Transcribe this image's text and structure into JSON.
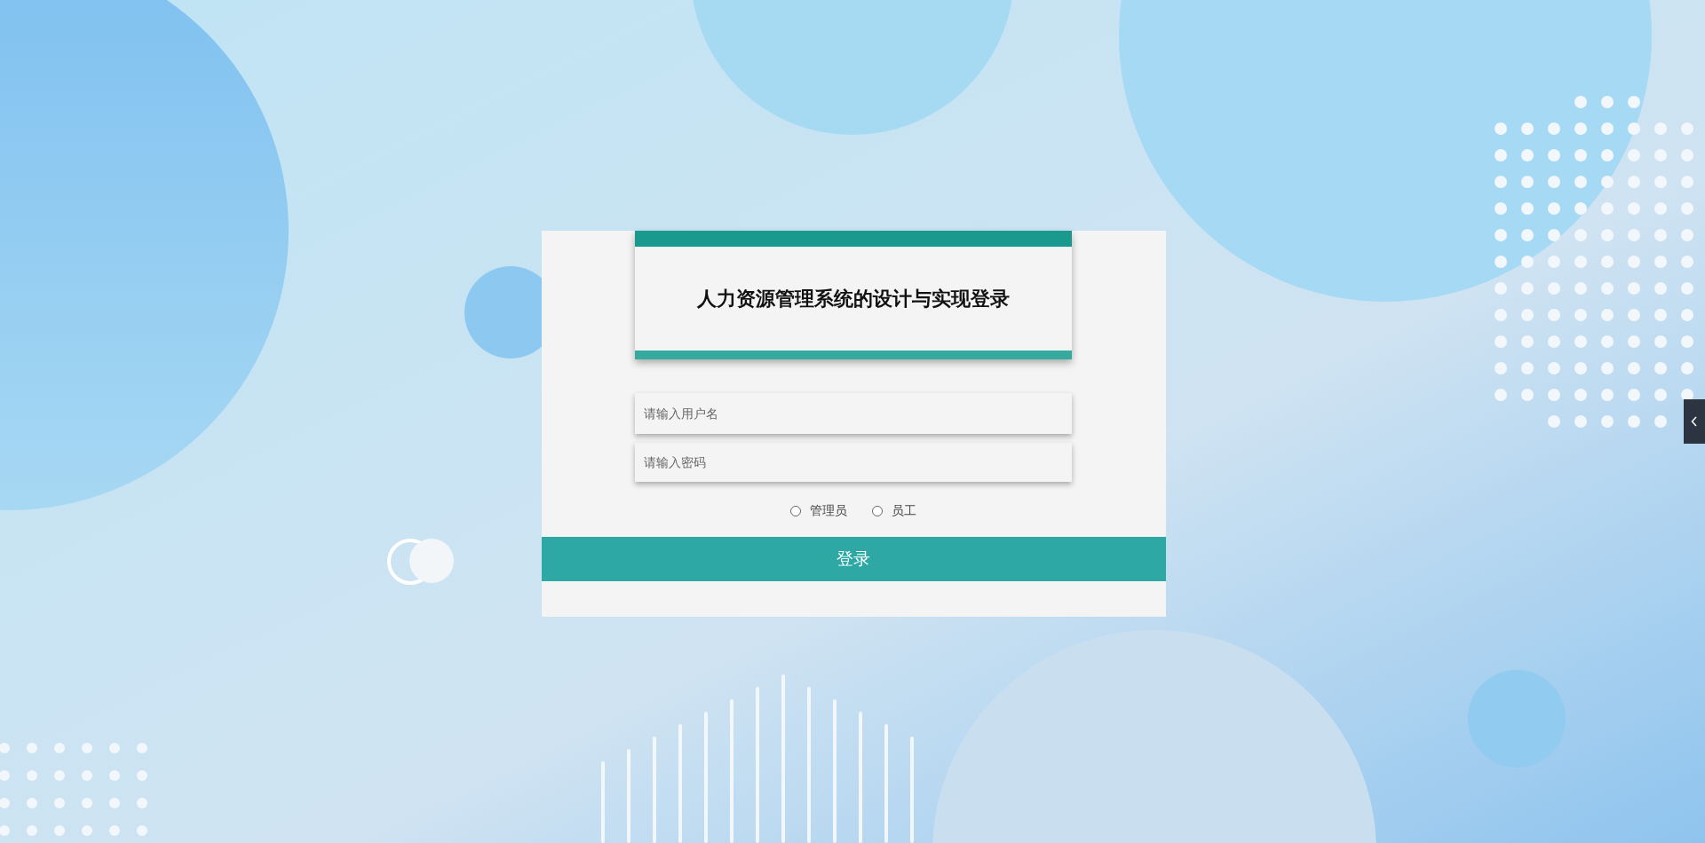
{
  "login": {
    "title": "人力资源管理系统的设计与实现登录",
    "username": {
      "placeholder": "请输入用户名"
    },
    "password": {
      "placeholder": "请输入密码"
    },
    "roles": [
      {
        "label": "管理员",
        "selected": false
      },
      {
        "label": "员工",
        "selected": false
      }
    ],
    "submit": "登录"
  }
}
